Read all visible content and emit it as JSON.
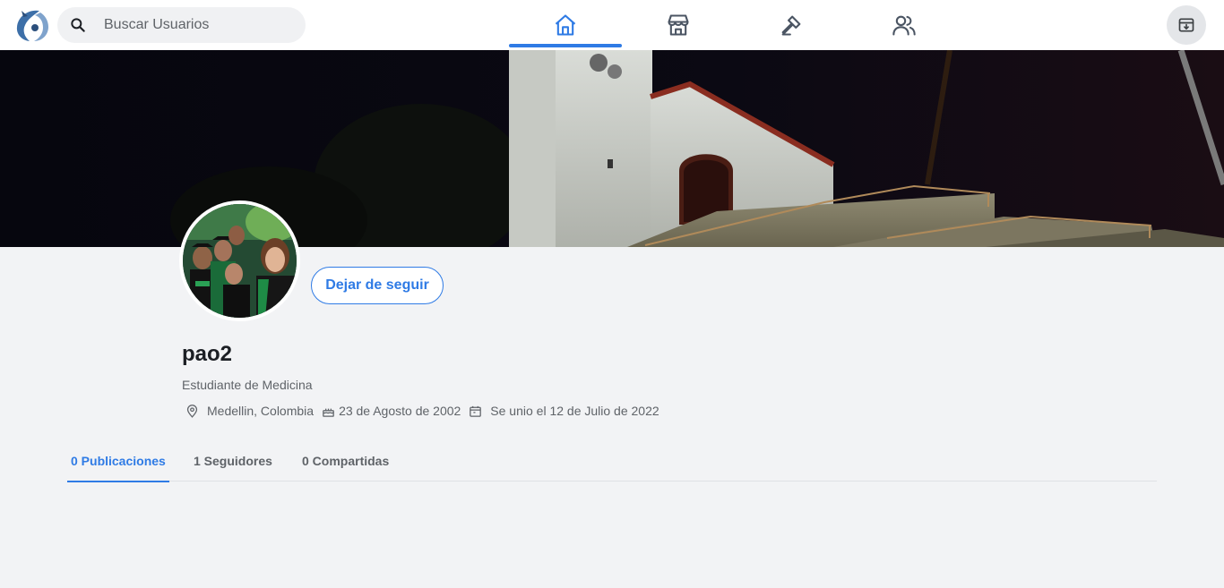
{
  "search": {
    "placeholder": "Buscar Usuarios"
  },
  "nav": {
    "tabs": [
      {
        "icon": "home-icon",
        "active": true
      },
      {
        "icon": "store-icon",
        "active": false
      },
      {
        "icon": "hammer-icon",
        "active": false
      },
      {
        "icon": "users-icon",
        "active": false
      }
    ],
    "right_button_icon": "archive-download-icon"
  },
  "profile": {
    "username": "pao2",
    "bio": "Estudiante de Medicina",
    "location": "Medellin, Colombia",
    "birthday": "23 de Agosto de 2002",
    "joined": "Se unio el 12 de Julio de 2022",
    "follow_button": "Dejar de seguir"
  },
  "profile_tabs": [
    {
      "label": "0 Publicaciones",
      "active": true
    },
    {
      "label": "1 Seguidores",
      "active": false
    },
    {
      "label": "0 Compartidas",
      "active": false
    }
  ],
  "colors": {
    "accent": "#2f7be5",
    "background": "#f2f3f5"
  }
}
